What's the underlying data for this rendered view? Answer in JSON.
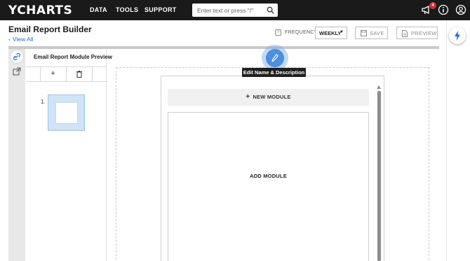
{
  "nav": {
    "logo_text": "YCHARTS",
    "links": [
      "DATA",
      "TOOLS",
      "SUPPORT"
    ],
    "search_placeholder": "Enter text or press \"/\"",
    "notification_count": "4",
    "icons": [
      "search-icon",
      "megaphone-icon",
      "info-icon",
      "user-icon"
    ]
  },
  "header": {
    "title": "Email Report Builder",
    "back_link": "View All",
    "frequency_help": "?",
    "frequency_label": "FREQUENCY:",
    "frequency_value": "WEEKLY",
    "save_label": "SAVE",
    "preview_label": "PREVIEW"
  },
  "preview_panel": {
    "title": "Email Report Module Preview",
    "add_symbol": "+",
    "thumbnails": [
      {
        "number": "1."
      }
    ]
  },
  "canvas": {
    "edit_tooltip": "Edit Name & Description",
    "new_module_plus": "+",
    "new_module_label": "NEW MODULE",
    "add_module_label": "ADD MODULE"
  },
  "colors": {
    "topnav_bg": "#1a1a1a",
    "accent_blue": "#4a8fe0",
    "link_blue": "#1e6ec4",
    "badge_red": "#d62b2b",
    "thumb_selected": "#cfe4f7"
  }
}
